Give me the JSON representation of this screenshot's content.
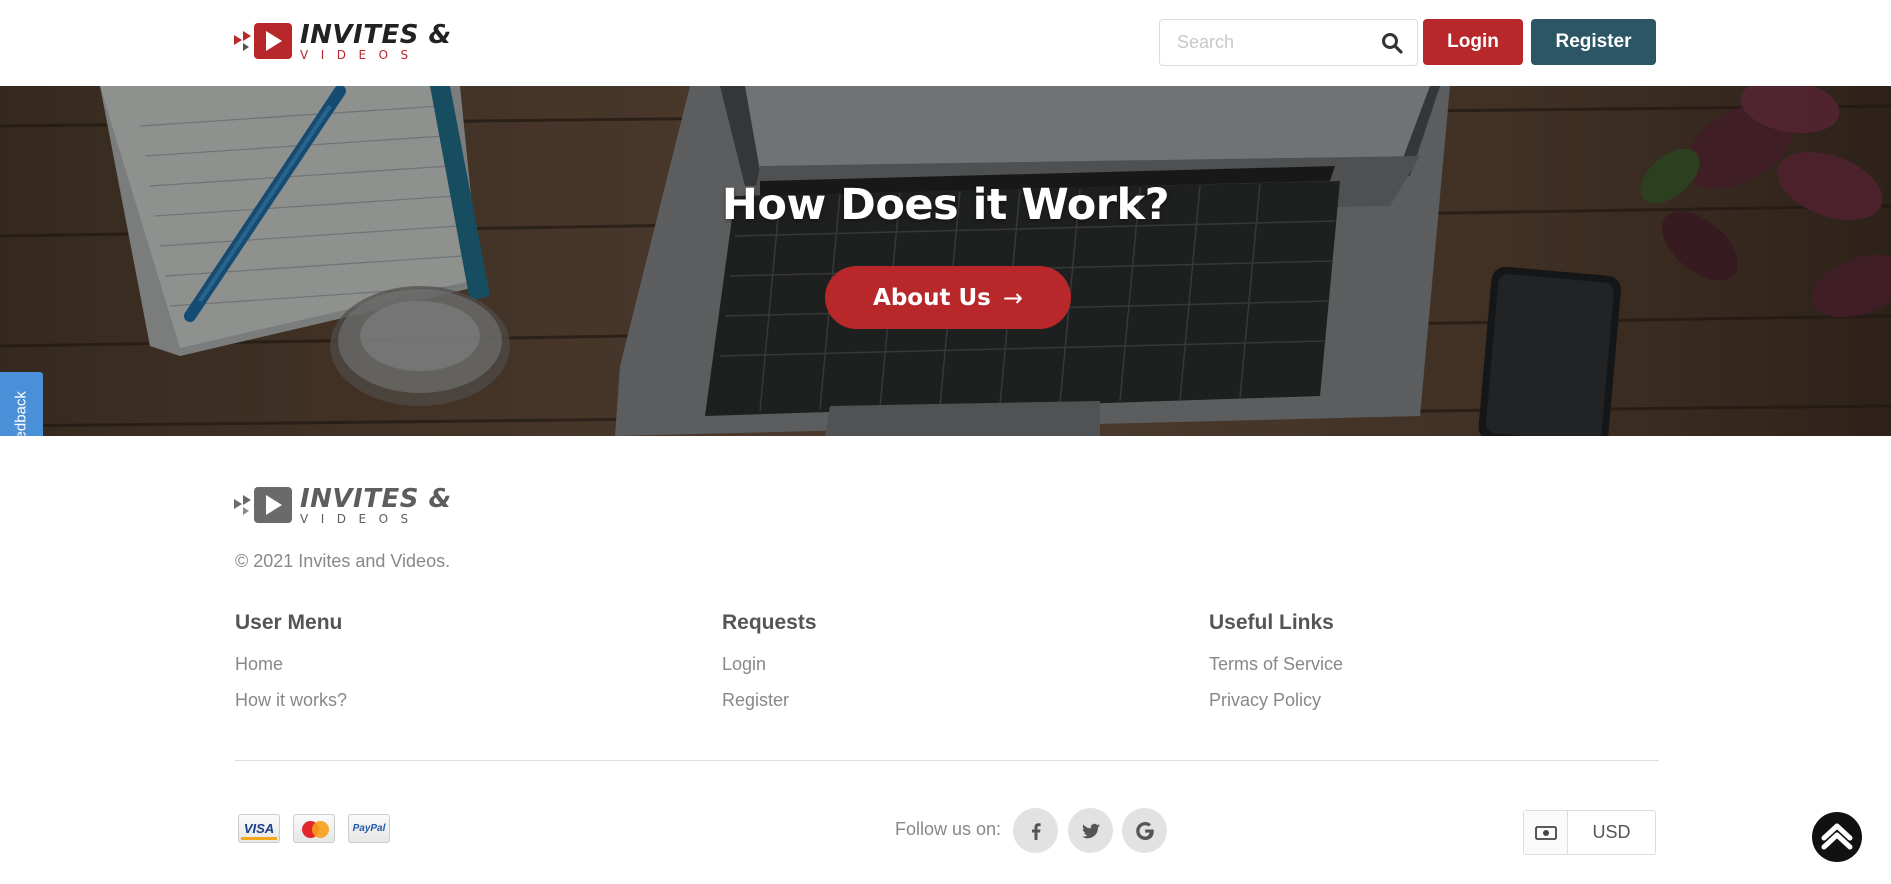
{
  "header": {
    "logo": {
      "line1": "INVITES &",
      "line2": "VIDEOS"
    },
    "search": {
      "placeholder": "Search",
      "value": ""
    },
    "login_label": "Login",
    "register_label": "Register"
  },
  "hero": {
    "title": "How Does it Work?",
    "button_label": "About Us",
    "button_arrow": "→"
  },
  "feedback_tab": {
    "label": "Feedback"
  },
  "footer": {
    "logo": {
      "line1": "INVITES &",
      "line2": "VIDEOS"
    },
    "copyright": "© 2021 Invites and Videos.",
    "columns": [
      {
        "heading": "User Menu",
        "links": [
          "Home",
          "How it works?"
        ]
      },
      {
        "heading": "Requests",
        "links": [
          "Login",
          "Register"
        ]
      },
      {
        "heading": "Useful Links",
        "links": [
          "Terms of Service",
          "Privacy Policy"
        ]
      }
    ],
    "payments": [
      {
        "name": "visa-card-icon",
        "label": "VISA"
      },
      {
        "name": "mastercard-icon",
        "label": ""
      },
      {
        "name": "paypal-card-icon",
        "label": "PayPal"
      }
    ],
    "follow_label": "Follow us on:",
    "social": [
      "facebook-icon",
      "twitter-icon",
      "google-icon"
    ],
    "currency": {
      "value": "USD",
      "icon": "money-icon"
    },
    "scroll_top_icon": "chevron-up-icon"
  },
  "colors": {
    "brand_red": "#b8282b",
    "brand_teal": "#2c5566",
    "feedback_blue": "#4a90d9"
  }
}
